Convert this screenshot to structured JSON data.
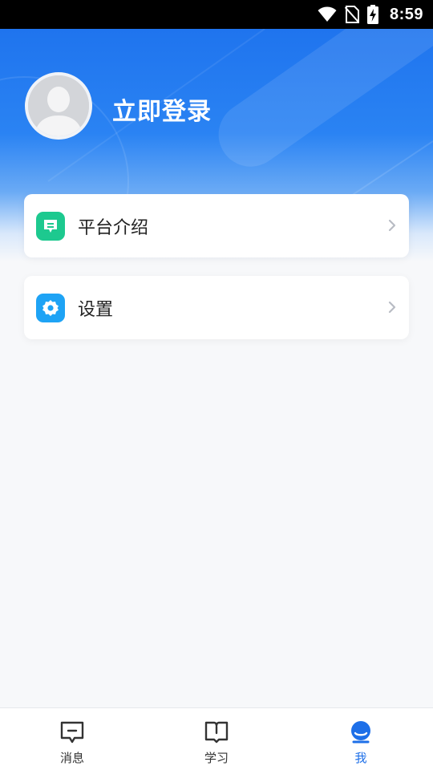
{
  "status_bar": {
    "time": "8:59",
    "icons": [
      "wifi-icon",
      "no-sim-icon",
      "battery-charging-icon"
    ]
  },
  "profile": {
    "avatar_icon": "default-avatar-icon",
    "login_text": "立即登录"
  },
  "menu": [
    {
      "label": "平台介绍",
      "icon": "platform-intro-icon",
      "icon_color": "#1dc98f"
    },
    {
      "label": "设置",
      "icon": "settings-gear-icon",
      "icon_color": "#1ea3f5"
    }
  ],
  "tabbar": {
    "tabs": [
      {
        "label": "消息",
        "icon": "message-icon",
        "active": false
      },
      {
        "label": "学习",
        "icon": "book-icon",
        "active": false
      },
      {
        "label": "我",
        "icon": "user-icon",
        "active": true
      }
    ],
    "active_color": "#1d6fe8"
  },
  "colors": {
    "header_blue": "#1f74ee",
    "background": "#f7f8fa"
  }
}
